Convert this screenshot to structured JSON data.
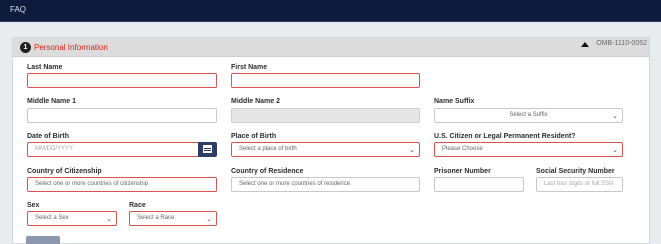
{
  "nav": {
    "faq": "FAQ"
  },
  "section": {
    "number": "1",
    "title": "Personal Information",
    "omb": "OMB-1110-0052"
  },
  "fields": {
    "last_name": {
      "label": "Last Name",
      "value": ""
    },
    "first_name": {
      "label": "First Name",
      "value": ""
    },
    "middle_name_1": {
      "label": "Middle Name 1",
      "value": ""
    },
    "middle_name_2": {
      "label": "Middle Name 2",
      "value": ""
    },
    "name_suffix": {
      "label": "Name Suffix",
      "value": "Select a Suffix"
    },
    "dob": {
      "label": "Date of Birth",
      "placeholder": "MM/DD/YYYY"
    },
    "place_of_birth": {
      "label": "Place of Birth",
      "value": "Select a place of birth"
    },
    "us_citizen": {
      "label": "U.S. Citizen or Legal Permanent Resident?",
      "value": "Please Choose"
    },
    "country_citizenship": {
      "label": "Country of Citizenship",
      "value": "Select one or more countries of citizenship"
    },
    "country_residence": {
      "label": "Country of Residence",
      "value": "Select one or more countries of residence"
    },
    "prisoner_number": {
      "label": "Prisoner Number",
      "value": ""
    },
    "ssn": {
      "label": "Social Security Number",
      "placeholder": "Last four digits or full SSN"
    },
    "sex": {
      "label": "Sex",
      "value": "Select a Sex"
    },
    "race": {
      "label": "Race",
      "value": "Select a Race"
    }
  },
  "colors": {
    "nav_bg": "#0f1b3c",
    "required_border": "#d9534f",
    "title_red": "#d9241b",
    "calendar_button": "#2c3e66"
  },
  "icons": [
    "chevron-up-icon",
    "chevron-down-icon",
    "calendar-icon"
  ]
}
